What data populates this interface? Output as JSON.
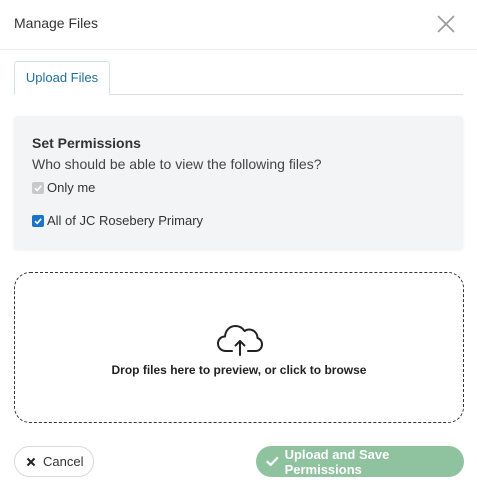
{
  "dialog": {
    "title": "Manage Files",
    "close_icon": "close-icon"
  },
  "tabs": [
    {
      "label": "Upload Files",
      "active": true
    }
  ],
  "permissions": {
    "heading": "Set Permissions",
    "question": "Who should be able to view the following files?",
    "options": [
      {
        "label": "Only me",
        "checked": true,
        "disabled": true
      },
      {
        "label": "All of JC Rosebery Primary",
        "checked": true,
        "disabled": false
      }
    ]
  },
  "dropzone": {
    "icon": "cloud-upload-icon",
    "text": "Drop files here to preview, or click to browse"
  },
  "footer": {
    "cancel_label": "Cancel",
    "cancel_icon": "times-icon",
    "upload_label": "Upload and Save Permissions",
    "upload_icon": "check-icon",
    "upload_color": "#8fc29f"
  }
}
